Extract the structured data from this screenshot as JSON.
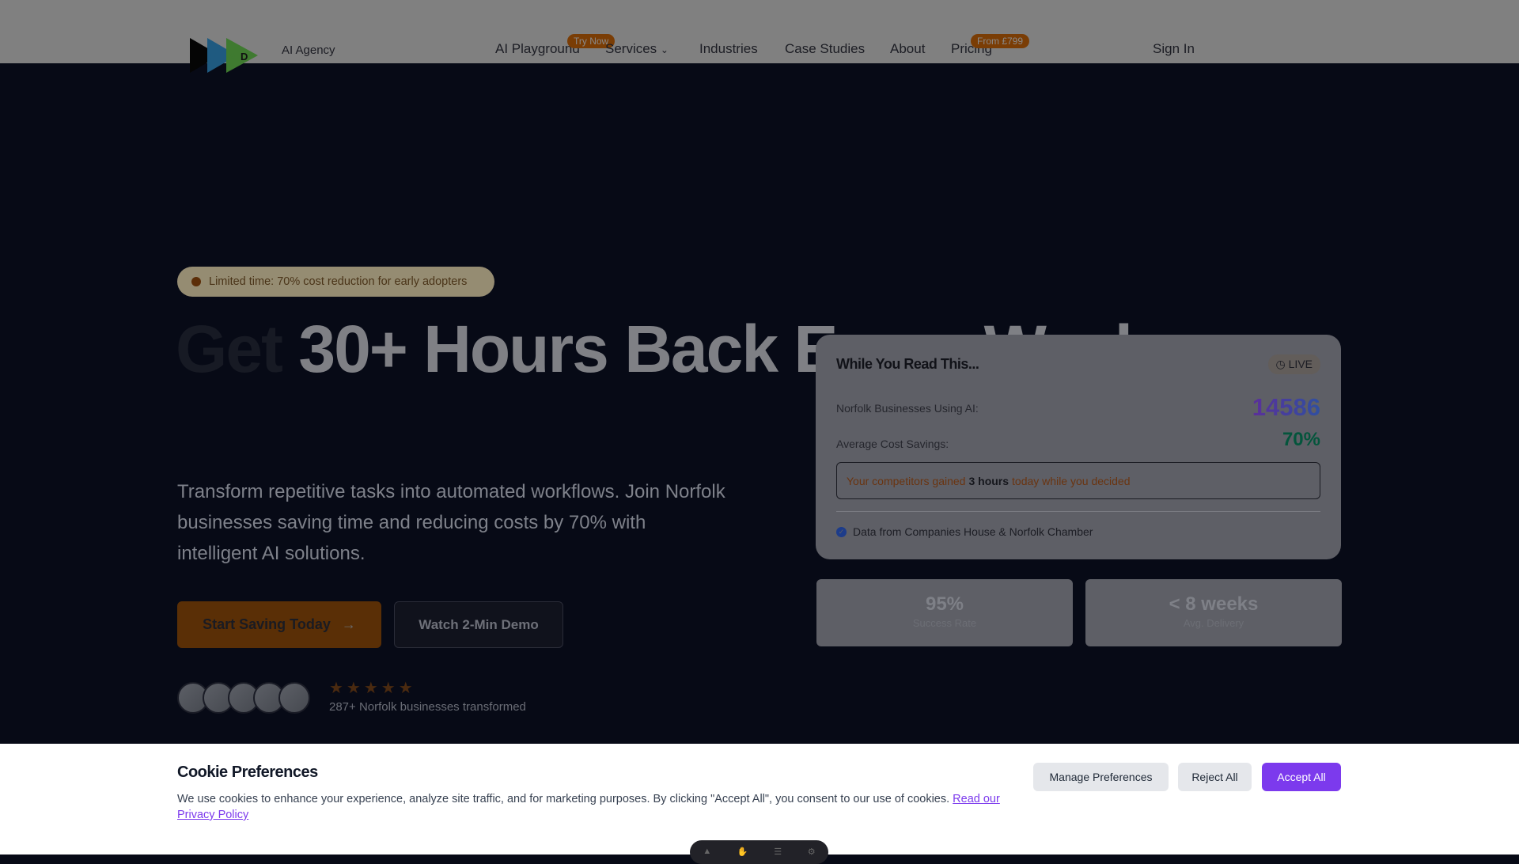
{
  "header": {
    "logo_letters": "FWD",
    "tagline": "AI Agency",
    "nav": [
      {
        "label": "AI Playground",
        "badge": "Try Now"
      },
      {
        "label": "Services"
      },
      {
        "label": "Industries"
      },
      {
        "label": "Case Studies"
      },
      {
        "label": "About"
      },
      {
        "label": "Pricing",
        "badge": "From £799"
      }
    ],
    "sign_in": "Sign In"
  },
  "hero": {
    "badge": "Limited time: 70% cost reduction for early adopters",
    "title_get": "Get",
    "title_rest": "30+ Hours Back Every Week",
    "lead": "Transform repetitive tasks into automated workflows. Join Norfolk businesses saving time and reducing costs by 70% with intelligent AI solutions.",
    "cta_primary": "Start Saving Today",
    "cta_secondary": "Watch 2-Min Demo",
    "rating_stars": 5,
    "proof": "287+ Norfolk businesses transformed"
  },
  "card": {
    "title": "While You Read This...",
    "live": "LIVE",
    "row1_label": "Norfolk Businesses Using AI:",
    "row1_value": "14586",
    "row2_label": "Average Cost Savings:",
    "row2_value": "70%",
    "alert_pre": "Your competitors gained",
    "alert_bold": "3 hours",
    "alert_post": "today while you decided",
    "source": "Data from Companies House & Norfolk Chamber"
  },
  "stats": [
    {
      "value": "95%",
      "label": "Success Rate"
    },
    {
      "value": "< 8 weeks",
      "label": "Avg. Delivery"
    }
  ],
  "cookie": {
    "title": "Cookie Preferences",
    "text": "We use cookies to enhance your experience, analyze site traffic, and for marketing purposes. By clicking \"Accept All\", you consent to our use of cookies.",
    "link": "Read our Privacy Policy",
    "manage": "Manage Preferences",
    "reject": "Reject All",
    "accept": "Accept All"
  },
  "colors": {
    "accent": "#7c3aed",
    "cta": "#d97706",
    "success": "#059669"
  }
}
